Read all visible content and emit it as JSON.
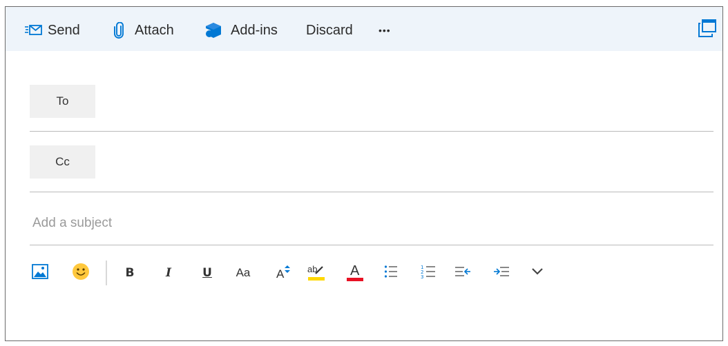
{
  "toolbar": {
    "send_label": "Send",
    "attach_label": "Attach",
    "addins_label": "Add-ins",
    "discard_label": "Discard",
    "more_label": "•••"
  },
  "compose": {
    "to_label": "To",
    "cc_label": "Cc",
    "to_value": "",
    "cc_value": "",
    "subject_placeholder": "Add a subject",
    "subject_value": ""
  },
  "format_toolbar": {
    "bold": "B",
    "italic": "I",
    "underline": "U",
    "font": "Aa",
    "font_size": "A",
    "highlight": "ab",
    "font_color": "A"
  },
  "colors": {
    "accent": "#0078d4",
    "highlight_bar": "#ffd800",
    "font_color_bar": "#e81123",
    "toolbar_bg": "#eef4fa"
  },
  "icons": {
    "send": "send-envelope-icon",
    "attach": "paperclip-icon",
    "addins": "addins-icon",
    "popout": "popout-window-icon",
    "insert_picture": "insert-picture-icon",
    "emoji": "emoji-icon",
    "bullets": "bullets-icon",
    "numbering": "numbering-icon",
    "outdent": "decrease-indent-icon",
    "indent": "increase-indent-icon",
    "more": "chevron-down-icon"
  }
}
